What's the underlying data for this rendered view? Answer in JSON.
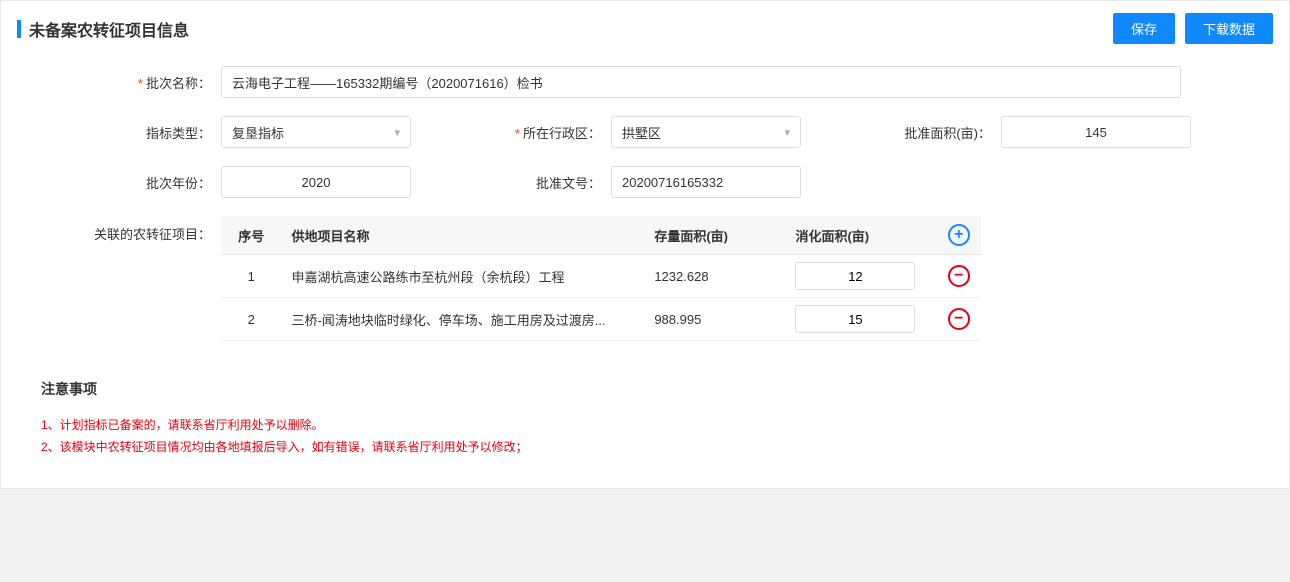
{
  "header": {
    "title": "未备案农转征项目信息",
    "save_label": "保存",
    "download_label": "下载数据"
  },
  "form": {
    "batch_name_label": "批次名称：",
    "batch_name_value": "云海电子工程——165332期编号（2020071616）检书",
    "indicator_type_label": "指标类型：",
    "indicator_type_value": "复垦指标",
    "region_label": "所在行政区：",
    "region_value": "拱墅区",
    "approved_area_label": "批准面积(亩)：",
    "approved_area_value": "145",
    "batch_year_label": "批次年份：",
    "batch_year_value": "2020",
    "approval_no_label": "批准文号：",
    "approval_no_value": "20200716165332",
    "assoc_label": "关联的农转征项目："
  },
  "table": {
    "headers": {
      "seq": "序号",
      "project_name": "供地项目名称",
      "stock_area": "存量面积(亩)",
      "consume_area": "消化面积(亩)"
    },
    "rows": [
      {
        "seq": "1",
        "name": "申嘉湖杭高速公路练市至杭州段（余杭段）工程",
        "stock": "1232.628",
        "consume": "12"
      },
      {
        "seq": "2",
        "name": "三桥-闻涛地块临时绿化、停车场、施工用房及过渡房...",
        "stock": "988.995",
        "consume": "15"
      }
    ]
  },
  "notice": {
    "title": "注意事项",
    "line1": "1、计划指标已备案的，请联系省厅利用处予以删除。",
    "line2": "2、该模块中农转征项目情况均由各地填报后导入，如有错误，请联系省厅利用处予以修改；"
  }
}
